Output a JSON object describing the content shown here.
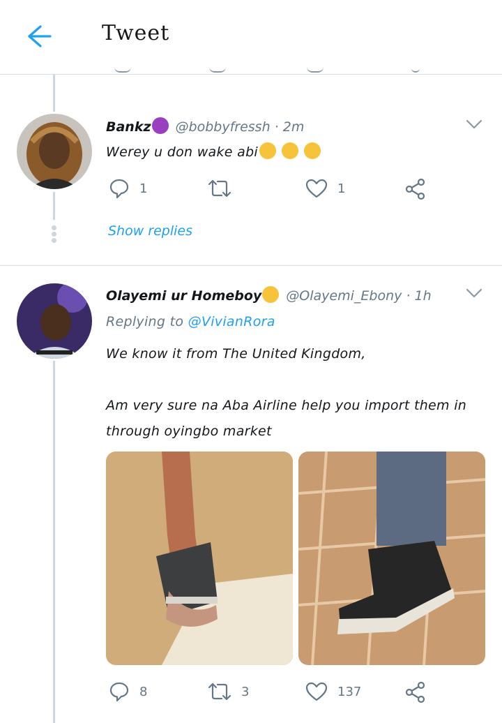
{
  "header": {
    "title": "Tweet"
  },
  "tweets": [
    {
      "name": "Bankz",
      "handle": "@bobbyfressh",
      "sep": "·",
      "time": "2m",
      "text": "Werey u don wake abi",
      "replies": "1",
      "retweets": "",
      "likes": "1",
      "show_replies": "Show replies"
    },
    {
      "name": "Olayemi ur Homeboy",
      "handle": "@Olayemi_Ebony",
      "sep": "·",
      "time": "1h",
      "replying_prefix": "Replying to",
      "replying_to": "@VivianRora",
      "line1": "We know it from The United Kingdom,",
      "line2": "Am very sure na Aba Airline help you import them in",
      "line3": "through oyingbo market",
      "replies": "8",
      "retweets": "3",
      "likes": "137"
    }
  ],
  "colors": {
    "accent": "#1da1f2",
    "muted": "#657786",
    "line": "#ccd6dd"
  }
}
